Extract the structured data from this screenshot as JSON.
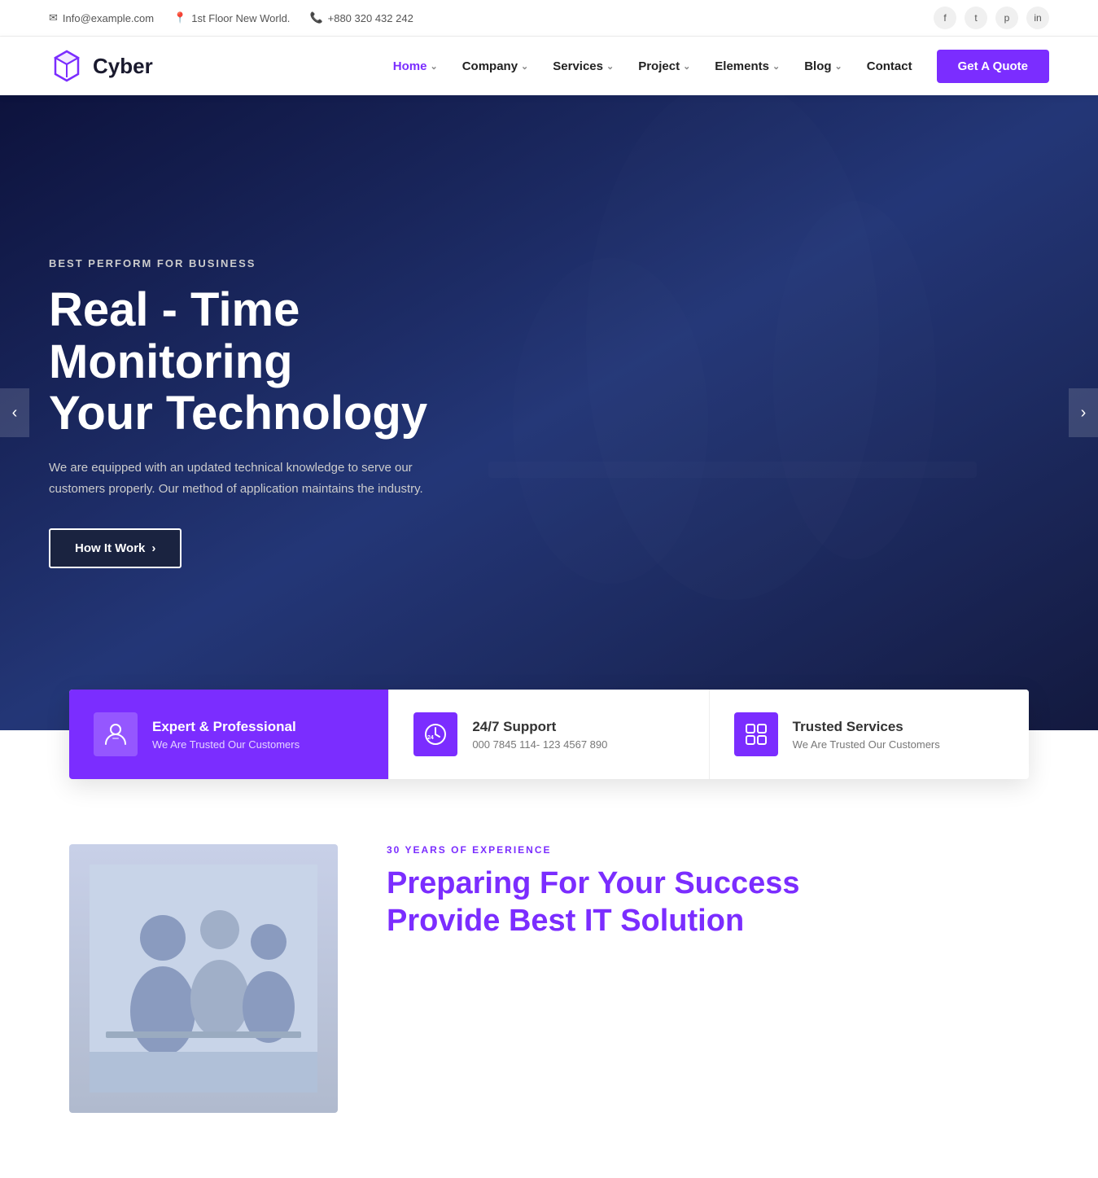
{
  "topbar": {
    "email": "Info@example.com",
    "address": "1st Floor New World.",
    "phone": "+880 320 432 242",
    "socials": [
      "f",
      "t",
      "p",
      "in"
    ]
  },
  "navbar": {
    "logo_text": "Cyber",
    "nav_items": [
      {
        "label": "Home",
        "has_dropdown": true,
        "active": true
      },
      {
        "label": "Company",
        "has_dropdown": true,
        "active": false
      },
      {
        "label": "Services",
        "has_dropdown": true,
        "active": false
      },
      {
        "label": "Project",
        "has_dropdown": true,
        "active": false
      },
      {
        "label": "Elements",
        "has_dropdown": true,
        "active": false
      },
      {
        "label": "Blog",
        "has_dropdown": true,
        "active": false
      },
      {
        "label": "Contact",
        "has_dropdown": false,
        "active": false
      }
    ],
    "cta_label": "Get A Quote"
  },
  "hero": {
    "subtitle": "BEST PERFORM FOR BUSINESS",
    "title_line1": "Real - Time Monitoring",
    "title_line2": "Your Technology",
    "description": "We are equipped with an updated technical knowledge to serve our customers properly. Our method of application maintains the industry.",
    "btn_label": "How It Work",
    "btn_icon": "›"
  },
  "features": [
    {
      "icon": "👤",
      "title": "Expert & Professional",
      "desc": "We Are Trusted Our Customers",
      "variant": "purple"
    },
    {
      "icon": "⏰",
      "title": "24/7 Support",
      "desc": "000 7845 114- 123 4567 890",
      "variant": "white"
    },
    {
      "icon": "⚙️",
      "title": "Trusted Services",
      "desc": "We Are Trusted Our Customers",
      "variant": "white"
    }
  ],
  "about": {
    "label": "30 YEARS OF EXPERIENCE",
    "title_line1": "Preparing For Your Success",
    "title_line2": "Provide Best IT Solution"
  },
  "icons": {
    "email": "✉",
    "location": "📍",
    "phone": "📞",
    "facebook": "f",
    "twitter": "t",
    "pinterest": "p",
    "linkedin": "in",
    "chevron_down": "⌄",
    "arrow_right": "›",
    "arrow_left": "‹"
  }
}
